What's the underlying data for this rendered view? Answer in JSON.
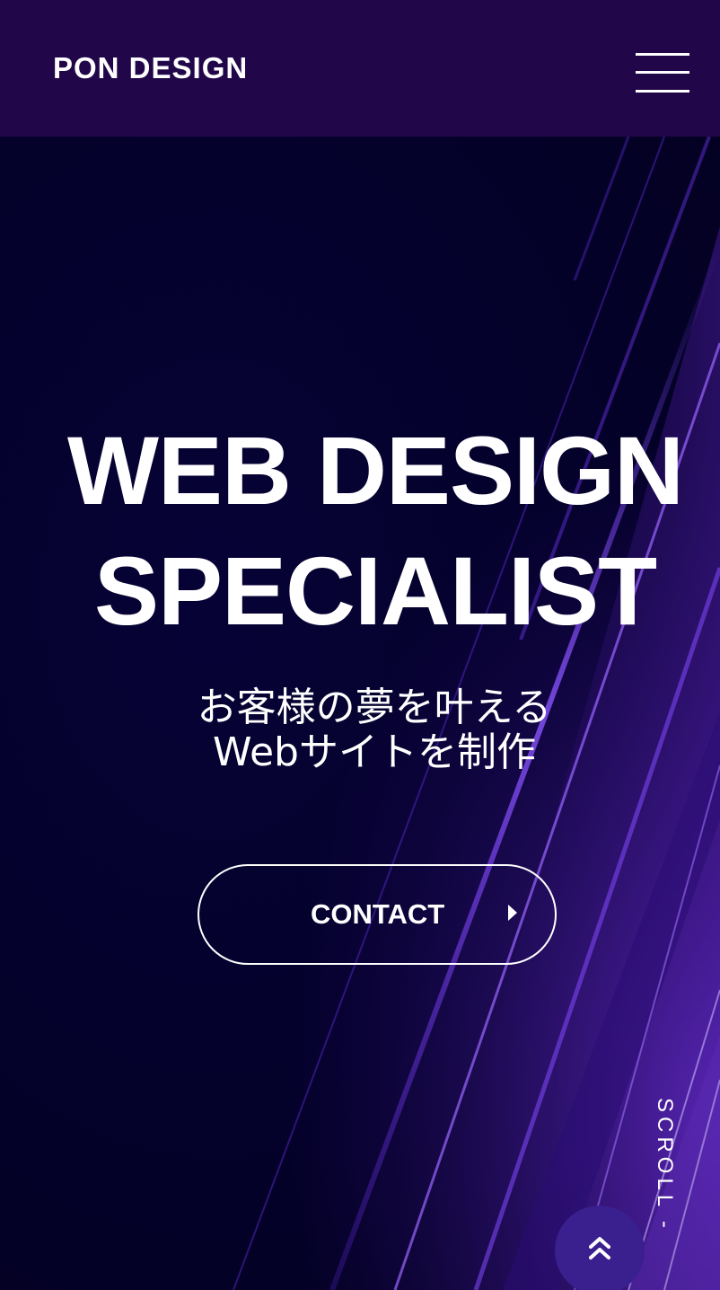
{
  "header": {
    "logo": "PON DESIGN",
    "menu_icon": "hamburger-menu-icon"
  },
  "hero": {
    "headline_line1": "WEB DESIGN",
    "headline_line2": "SPECIALIST",
    "subtitle_line1": "お客様の夢を叶える",
    "subtitle_line2": "Webサイトを制作",
    "cta_label": "CONTACT",
    "cta_icon": "caret-right-icon",
    "scroll_label": "SCROLL -",
    "pagetop_icon": "double-chevron-up-icon"
  },
  "colors": {
    "header_bg": "#22064a",
    "hero_bg": "#04012a",
    "accent_purple": "#7a3cf0",
    "pagetop_bg": "#3a1f8e",
    "text": "#ffffff"
  }
}
